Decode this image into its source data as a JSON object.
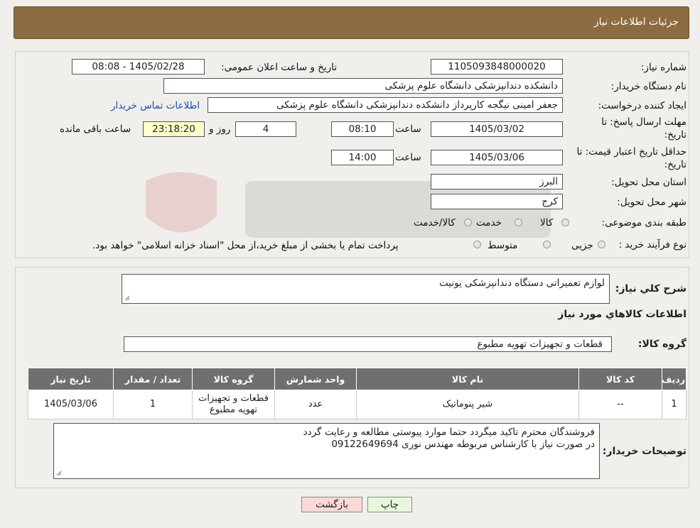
{
  "header": {
    "title": "جزئیات اطلاعات نیاز"
  },
  "fields": {
    "need_number_label": "شماره نیاز:",
    "need_number": "1105093848000020",
    "announce_label": "تاریخ و ساعت اعلان عمومی:",
    "announce_value": "1405/02/28 - 08:08",
    "buyer_org_label": "نام دستگاه خریدار:",
    "buyer_org": "دانشکده دندانپزشکی دانشگاه علوم پزشکی",
    "creator_label": "ایجاد کننده درخواست:",
    "creator": "جعفر امینی نیگجه کارپرداز دانشکده دندانپزشکی دانشگاه علوم پزشکی",
    "contact_link": "اطلاعات تماس خریدار",
    "deadline_label_1": "مهلت ارسال پاسخ: تا",
    "deadline_label_2": "تاریخ:",
    "deadline_date": "1405/03/02",
    "time_label": "ساعت",
    "deadline_time": "08:10",
    "days_value": "4",
    "days_label": "روز و",
    "remaining_time": "23:18:20",
    "remaining_label": "ساعت باقی مانده",
    "validity_label_1": "حداقل تاریخ اعتبار قیمت: تا",
    "validity_label_2": "تاریخ:",
    "validity_date": "1405/03/06",
    "validity_time": "14:00",
    "province_label": "استان محل تحویل:",
    "province": "البرز",
    "city_label": "شهر محل تحویل:",
    "city": "کرج",
    "category_label": "طبقه بندی موضوعی:",
    "category_options": [
      "کالا",
      "خدمت",
      "کالا/خدمت"
    ],
    "process_label": "نوع فرآیند خرید :",
    "process_options": [
      "جزیی",
      "متوسط"
    ],
    "process_note": "پرداخت تمام یا بخشی از مبلغ خرید،از محل \"اسناد خزانه اسلامی\" خواهد بود."
  },
  "summary": {
    "label": "شرح کلي نياز:",
    "value": "لوازم تعمیراتی دستگاه دندانپزشکی یونیت",
    "goods_info_title": "اطلاعات کالاهاي مورد نياز",
    "group_label": "گروه کالا:",
    "group_value": "قطعات و تجهیزات تهویه مطبوع"
  },
  "table": {
    "headers": [
      "ردیف",
      "کد کالا",
      "نام کالا",
      "واحد شمارش",
      "گروه کالا",
      "تعداد / مقدار",
      "تاریخ نیاز"
    ],
    "rows": [
      [
        "1",
        "--",
        "شیر پنوماتیک",
        "عدد",
        "قطعات و تجهیزات تهویه مطبوع",
        "1",
        "1405/03/06"
      ]
    ]
  },
  "buyer_notes": {
    "label": "توضیحات خریدار:",
    "line1": "فروشندگان محترم تاکید میگردد حتما موارد پیوستی مطالعه و رعایت گردد",
    "line2": "در صورت نیاز با کارشناس مربوطه مهندس نوری 09122649694"
  },
  "buttons": {
    "print": "چاپ",
    "back": "بازگشت"
  },
  "colors": {
    "header": "#8b6b3f",
    "back_button": "#fbd9d9",
    "print_button": "#e8f7dc",
    "yellow_box": "#ffffcc"
  }
}
